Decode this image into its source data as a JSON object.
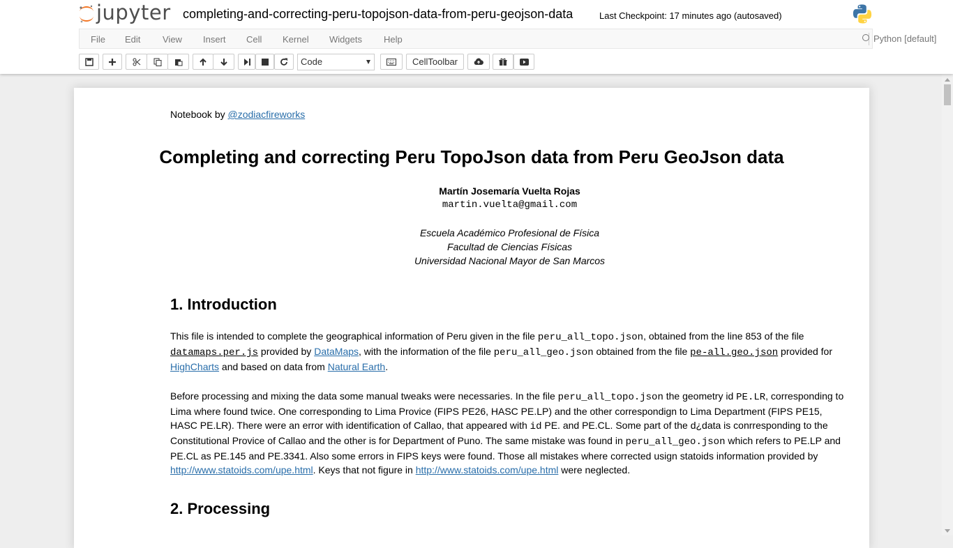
{
  "header": {
    "logo_text": "jupyter",
    "notebook_name": "completing-and-correcting-peru-topojson-data-from-peru-geojson-data",
    "checkpoint": "Last Checkpoint: 17 minutes ago (autosaved)"
  },
  "menu": [
    "File",
    "Edit",
    "View",
    "Insert",
    "Cell",
    "Kernel",
    "Widgets",
    "Help"
  ],
  "kernel": {
    "name": "Python [default]"
  },
  "toolbar": {
    "cell_type": "Code",
    "celltoolbar_label": "CellToolbar"
  },
  "notebook": {
    "author_prefix": "Notebook by ",
    "author_handle": "@zodiacfireworks",
    "title": "Completing and correcting Peru TopoJson data from Peru GeoJson data",
    "author_name": "Martín Josemaría Vuelta Rojas",
    "author_email": "martin.vuelta@gmail.com",
    "affiliation": [
      "Escuela Académico Profesional de Física",
      "Facultad de Ciencias Físicas",
      "Universidad Nacional Mayor de San Marcos"
    ],
    "sections": [
      {
        "heading": "1. Introduction"
      },
      {
        "heading": "2. Processing"
      }
    ],
    "intro_p1": {
      "t1": "This file is intended to complete the geographical information of Peru given in the file ",
      "c1": "peru_all_topo.json",
      "t2": ", obtained from the line 853 of the file ",
      "c2": "datamaps.per.js",
      "t3": " provided by ",
      "l1": "DataMaps",
      "t4": ", with the information of the file ",
      "c3": "peru_all_geo.json",
      "t5": " obtained from the file ",
      "c4": "pe-all.geo.json",
      "t6": " provided for ",
      "l2": "HighCharts",
      "t7": " and based on data from ",
      "l3": "Natural Earth",
      "t8": "."
    },
    "intro_p2": {
      "t1": "Before processing and mixing the data some manual tweaks were necessaries. In the file ",
      "c1": "peru_all_topo.json",
      "t2": " the geometry id ",
      "c2": "PE.LR",
      "t3": ", corresponding to Lima where found twice. One corresponding to Lima Provice (FIPS PE26, HASC PE.LP) and the other correspondign to Lima Department (FIPS PE15, HASC PE.LR). There were an error with identification of Callao, that appeared with ",
      "c3": "id",
      "t4": " PE. and PE.CL. Some part of the d¿data is conrresponding to the Constitutional Provice of Callao and the other is for Department of Puno. The same mistake was found in ",
      "c4": "peru_all_geo.json",
      "t5": " which refers to PE.LP and PE.CL as PE.145 and PE.3341. Also some errors in FIPS keys were found. Those all mistakes where corrected usign statoids information provided by ",
      "l1": "http://www.statoids.com/upe.html",
      "t6": ". Keys that not figure in ",
      "l2": "http://www.statoids.com/upe.html",
      "t7": " were neglected."
    }
  }
}
